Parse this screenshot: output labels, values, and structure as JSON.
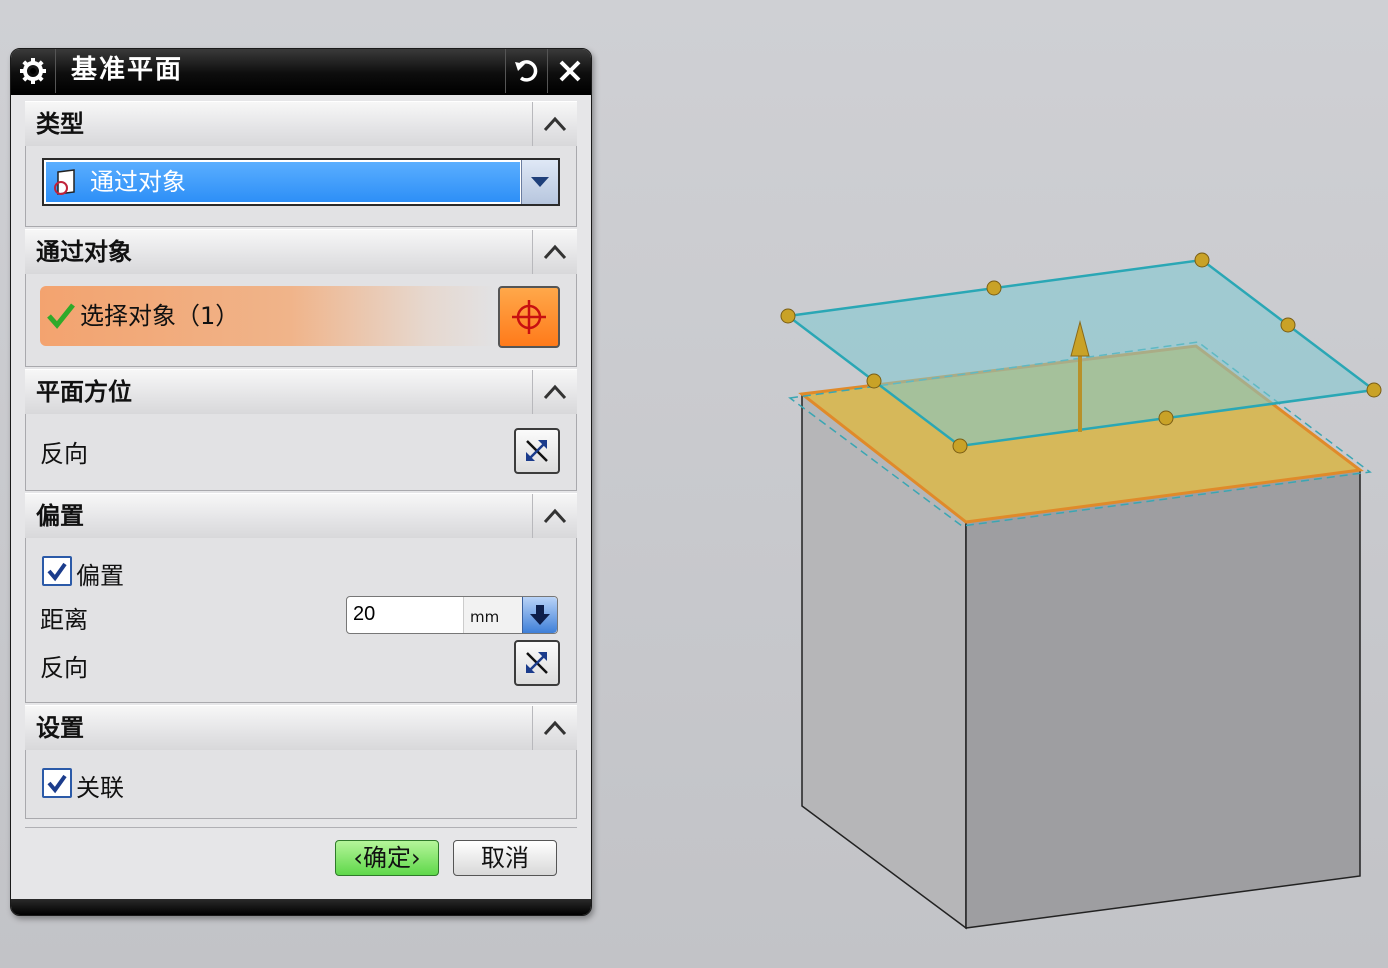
{
  "dialog": {
    "title": "基准平面",
    "icons": {
      "settings": "gear-icon",
      "reset": "reset-icon",
      "close": "close-icon"
    }
  },
  "sections": {
    "type": {
      "label": "类型",
      "selected": "通过对象"
    },
    "through_object": {
      "label": "通过对象",
      "select_text": "选择对象（1）"
    },
    "plane_orientation": {
      "label": "平面方位",
      "reverse_label": "反向"
    },
    "offset": {
      "label": "偏置",
      "offset_checkbox_label": "偏置",
      "offset_checked": true,
      "distance_label": "距离",
      "distance_value": "20",
      "distance_unit": "mm",
      "reverse_label": "反向"
    },
    "settings": {
      "label": "设置",
      "associative_label": "关联",
      "associative_checked": true
    }
  },
  "buttons": {
    "ok": "确定",
    "cancel": "取消"
  },
  "colors": {
    "title_bar": "#000000",
    "selection_blue": "#2d8ff7",
    "select_highlight": "#f3a36f",
    "target_button": "#ff7a1a",
    "ok_green": "#5fd84a",
    "plane_cyan": "#7fc8cf",
    "top_face": "#d6b85a",
    "handle": "#c9a227"
  }
}
